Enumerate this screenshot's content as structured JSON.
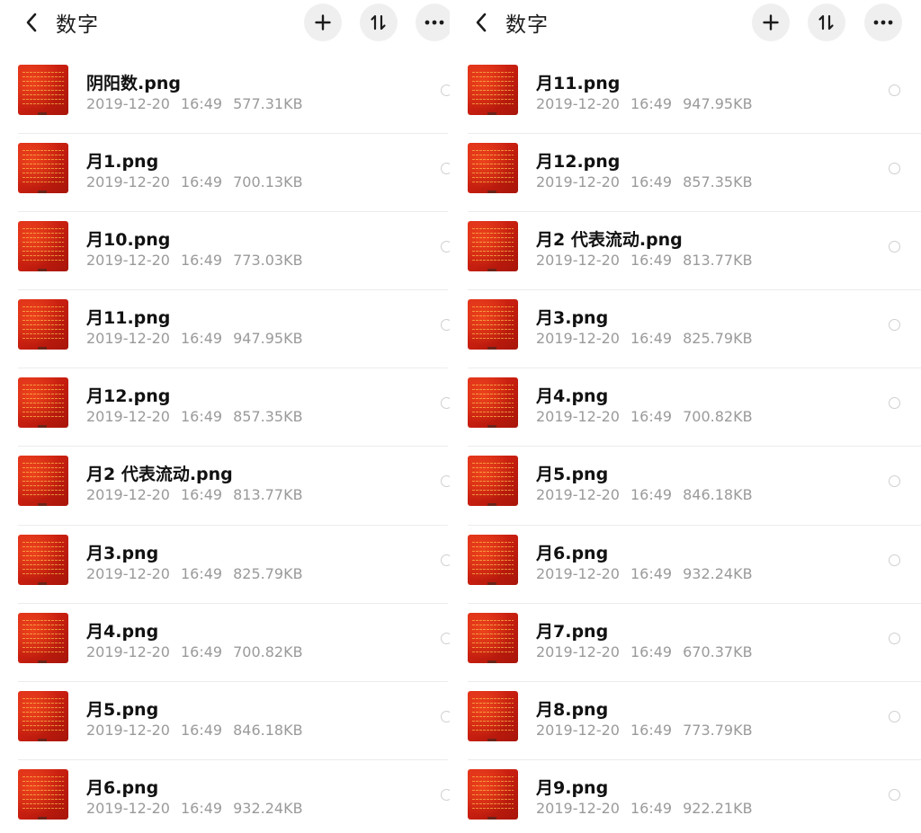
{
  "panes": [
    {
      "header": {
        "title": "数字",
        "back_icon": "chevron-left-icon",
        "add_icon": "plus-icon",
        "sort_icon": "sort-icon",
        "more_icon": "more-horizontal-icon"
      },
      "files": [
        {
          "name": "阴阳数.png",
          "date": "2019-12-20",
          "time": "16:49",
          "size": "577.31KB"
        },
        {
          "name": "月1.png",
          "date": "2019-12-20",
          "time": "16:49",
          "size": "700.13KB"
        },
        {
          "name": "月10.png",
          "date": "2019-12-20",
          "time": "16:49",
          "size": "773.03KB"
        },
        {
          "name": "月11.png",
          "date": "2019-12-20",
          "time": "16:49",
          "size": "947.95KB"
        },
        {
          "name": "月12.png",
          "date": "2019-12-20",
          "time": "16:49",
          "size": "857.35KB"
        },
        {
          "name": "月2 代表流动.png",
          "date": "2019-12-20",
          "time": "16:49",
          "size": "813.77KB"
        },
        {
          "name": "月3.png",
          "date": "2019-12-20",
          "time": "16:49",
          "size": "825.79KB"
        },
        {
          "name": "月4.png",
          "date": "2019-12-20",
          "time": "16:49",
          "size": "700.82KB"
        },
        {
          "name": "月5.png",
          "date": "2019-12-20",
          "time": "16:49",
          "size": "846.18KB"
        },
        {
          "name": "月6.png",
          "date": "2019-12-20",
          "time": "16:49",
          "size": "932.24KB"
        }
      ]
    },
    {
      "header": {
        "title": "数字",
        "back_icon": "chevron-left-icon",
        "add_icon": "plus-icon",
        "sort_icon": "sort-icon",
        "more_icon": "more-horizontal-icon"
      },
      "files": [
        {
          "name": "月11.png",
          "date": "2019-12-20",
          "time": "16:49",
          "size": "947.95KB"
        },
        {
          "name": "月12.png",
          "date": "2019-12-20",
          "time": "16:49",
          "size": "857.35KB"
        },
        {
          "name": "月2 代表流动.png",
          "date": "2019-12-20",
          "time": "16:49",
          "size": "813.77KB"
        },
        {
          "name": "月3.png",
          "date": "2019-12-20",
          "time": "16:49",
          "size": "825.79KB"
        },
        {
          "name": "月4.png",
          "date": "2019-12-20",
          "time": "16:49",
          "size": "700.82KB"
        },
        {
          "name": "月5.png",
          "date": "2019-12-20",
          "time": "16:49",
          "size": "846.18KB"
        },
        {
          "name": "月6.png",
          "date": "2019-12-20",
          "time": "16:49",
          "size": "932.24KB"
        },
        {
          "name": "月7.png",
          "date": "2019-12-20",
          "time": "16:49",
          "size": "670.37KB"
        },
        {
          "name": "月8.png",
          "date": "2019-12-20",
          "time": "16:49",
          "size": "773.79KB"
        },
        {
          "name": "月9.png",
          "date": "2019-12-20",
          "time": "16:49",
          "size": "922.21KB"
        }
      ]
    }
  ]
}
